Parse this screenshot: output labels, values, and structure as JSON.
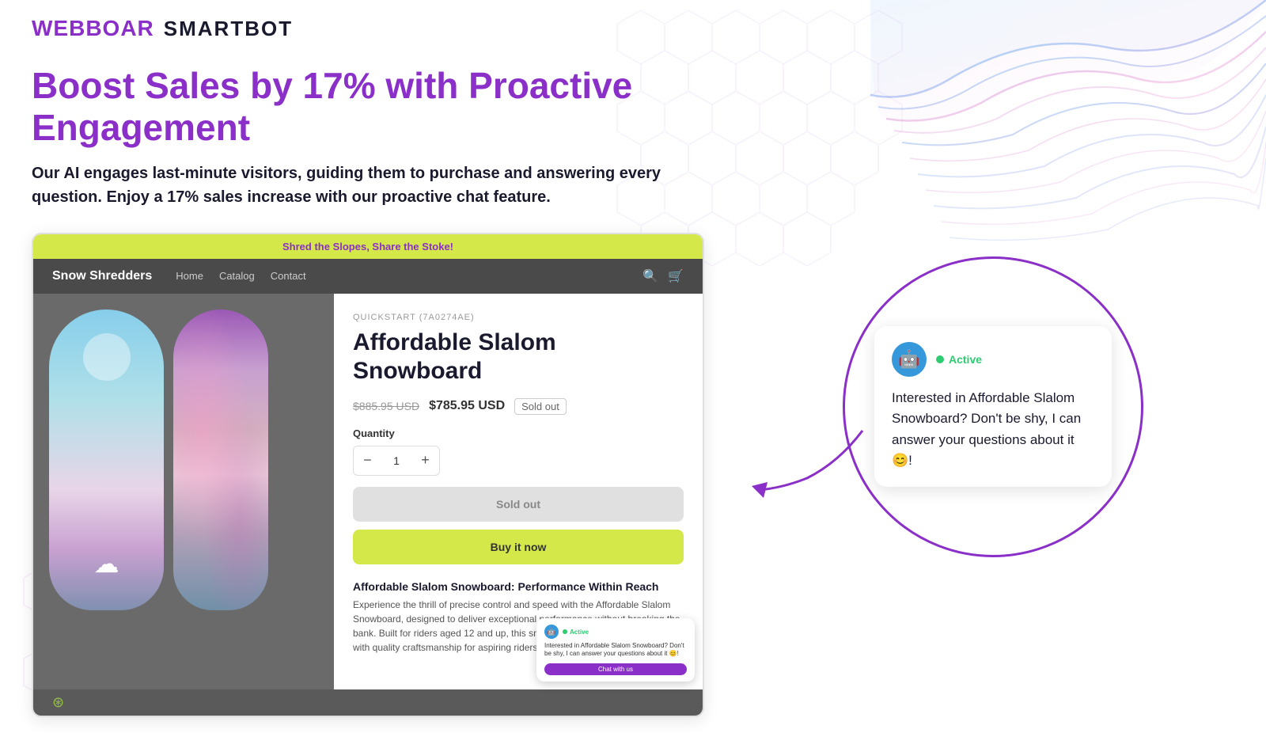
{
  "logo": {
    "webboar": "WEBBOAR",
    "smartbot": "SMARTBOT"
  },
  "hero": {
    "title": "Boost Sales by 17% with Proactive Engagement",
    "subtitle": "Our AI engages last-minute visitors, guiding them to purchase and answering every question. Enjoy a 17% sales increase with our proactive chat feature."
  },
  "shopify": {
    "announcement": "Shred the Slopes, Share the Stoke!",
    "store_name": "Snow Shredders",
    "nav_links": [
      "Home",
      "Catalog",
      "Contact"
    ],
    "product": {
      "sku": "QUICKSTART (7A0274AE)",
      "name": "Affordable Slalom Snowboard",
      "price_original": "$885.95 USD",
      "price_sale": "$785.95 USD",
      "sold_out_badge": "Sold out",
      "quantity_label": "Quantity",
      "quantity_value": "1",
      "qty_minus": "−",
      "qty_plus": "+",
      "btn_sold_out": "Sold out",
      "btn_buy_now": "Buy it now",
      "desc_title": "Affordable Slalom Snowboard: Performance Within Reach",
      "description": "Experience the thrill of precise control and speed with the Affordable Slalom Snowboard, designed to deliver exceptional performance without breaking the bank. Built for riders aged 12 and up, this snowboard combines affordability with quality craftsmanship for aspiring riders and enthusiasts alike."
    },
    "mini_chat": {
      "active": "Active",
      "message": "Interested in Affordable Slalom Snowboard? Don't be shy, I can answer your questions about it 😊!",
      "button": "Chat with us"
    }
  },
  "chat_popup": {
    "status": "Active",
    "avatar_emoji": "🤖",
    "message": "Interested in Affordable Slalom Snowboard? Don't be shy, I can answer your questions about it 😊!",
    "emoji": "😊"
  }
}
